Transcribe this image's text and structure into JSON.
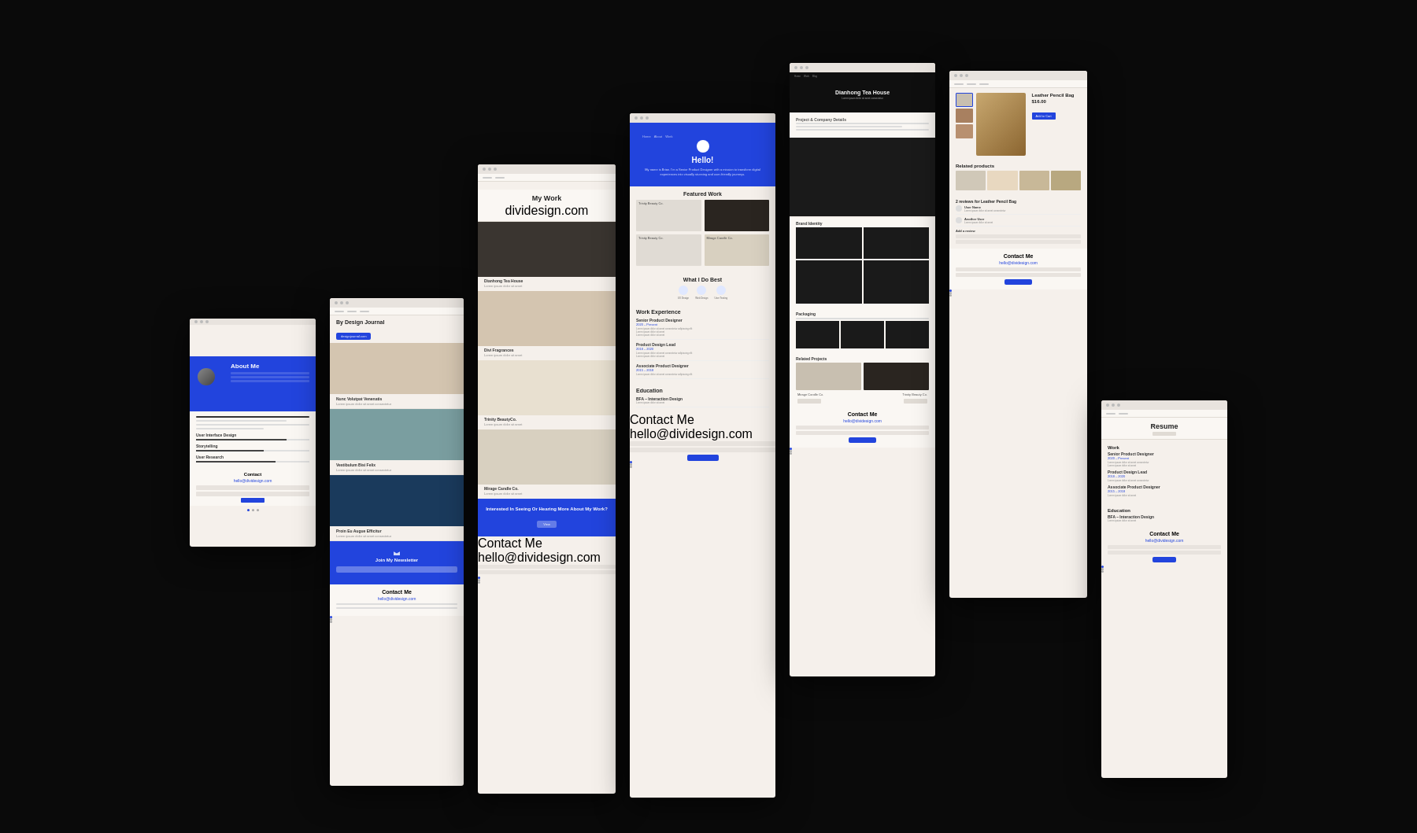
{
  "background": "#0a0a0a",
  "cards": {
    "card1": {
      "title": "About Me",
      "subtitle": "Contact",
      "email": "hello@dividesign.com",
      "skills": [
        "User Interface Design",
        "Storytelling",
        "User Research"
      ],
      "skill_levels": [
        0.8,
        0.6,
        0.7
      ]
    },
    "card2": {
      "title": "By Design Journal",
      "blue_btn": "designjournal.com",
      "posts": [
        {
          "title": "Nunc Volutpat Venenatis",
          "excerpt": "Lorem ipsum"
        },
        {
          "title": "Vestibulum Bisi Felix",
          "excerpt": "Lorem ipsum"
        },
        {
          "title": "Proin Eu Augue Efficitur",
          "excerpt": "Lorem ipsum"
        }
      ],
      "newsletter_title": "Join My Newsletter",
      "contact_title": "Contact Me",
      "contact_email": "hello@dividesign.com"
    },
    "card3": {
      "title": "My Work",
      "subtitle": "dividesign.com",
      "projects": [
        {
          "title": "Dianhong Tea House",
          "desc": "Lorem ipsum dolor sit amet"
        },
        {
          "title": "Divi Fragrances",
          "desc": "Lorem ipsum dolor sit amet"
        },
        {
          "title": "Trinity BeautyCo.",
          "desc": "Lorem ipsum dolor sit amet"
        },
        {
          "title": "Mirage Candle Co.",
          "desc": "Lorem ipsum dolor sit amet"
        }
      ],
      "cta_title": "Interested In Seeing Or Hearing More About My Work?",
      "contact_title": "Contact Me",
      "contact_email": "hello@dividesign.com"
    },
    "card4": {
      "hello_title": "Hello!",
      "hero_text": "My name is Brian. I'm a Senior Product Designer with a mission to transform digital experiences into visually stunning and user-friendly journeys.",
      "featured_title": "Featured Work",
      "featured_items": [
        {
          "label": "Trinity Beauty Co."
        },
        {
          "label": "Mirage Candle Co."
        },
        {
          "label": "Trinity Beauty Co."
        },
        {
          "label": "Mirage Candle Co."
        }
      ],
      "best_title": "What I Do Best",
      "best_items": [
        {
          "icon": "ux",
          "label": "UX Design"
        },
        {
          "icon": "web",
          "label": "Web Design"
        },
        {
          "icon": "user",
          "label": "User Testing"
        }
      ],
      "work_exp_title": "Work Experience",
      "jobs": [
        {
          "title": "Senior Product Designer",
          "date": "2020 – Present",
          "desc": "Lorem ipsum dolor sit amet"
        },
        {
          "title": "Product Design Lead",
          "date": "2018 – 2020",
          "desc": "Lorem ipsum dolor sit amet"
        },
        {
          "title": "Associate Product Designer",
          "date": "2015 – 2018",
          "desc": "Lorem ipsum dolor sit amet"
        }
      ],
      "education_title": "Education",
      "education": [
        {
          "title": "BFA – Interaction Design",
          "desc": "Lorem ipsum"
        }
      ],
      "contact_title": "Contact Me",
      "contact_email": "hello@dividesign.com"
    },
    "card5": {
      "tea_name": "Dianhong Tea House",
      "tea_desc": "Lorem ipsum dolor sit amet consectetur",
      "project_label": "Project & Company Details",
      "brand_label": "Brand Identity",
      "packaging_label": "Packaging",
      "related_title": "Related Projects",
      "related_items": [
        "Mirage Candle Co.",
        "Trinity Beauty Co."
      ],
      "contact_title": "Contact Me",
      "contact_email": "hello@dividesign.com"
    },
    "card6": {
      "product_name": "Leather Pencil Bag",
      "product_price": "$16.00",
      "related_title": "Related products",
      "reviews_title": "2 reviews for Leather Pencil Bag",
      "contact_title": "Contact Me",
      "contact_email": "hello@dividesign.com"
    },
    "card7": {
      "title": "Resume",
      "work_title": "Work",
      "jobs": [
        {
          "title": "Senior Product Designer",
          "date": "2020 – Present"
        },
        {
          "title": "Product Design Lead",
          "date": "2018 – 2020"
        },
        {
          "title": "Associate Product Designer",
          "date": "2015 – 2018"
        }
      ],
      "education_title": "Education",
      "education": "BFA – Interaction Design",
      "contact_title": "Contact Me",
      "contact_email": "hello@dividesign.com"
    }
  }
}
